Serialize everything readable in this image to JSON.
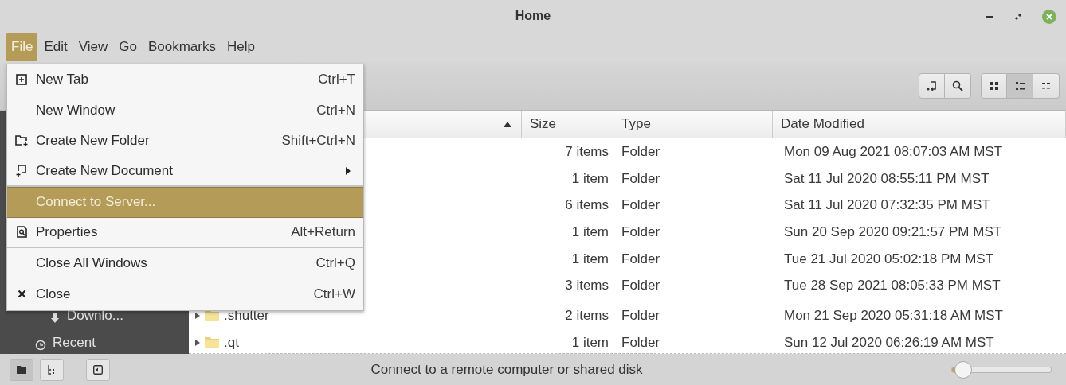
{
  "window": {
    "title": "Home"
  },
  "menubar": [
    {
      "label": "File",
      "selected": true
    },
    {
      "label": "Edit",
      "selected": false
    },
    {
      "label": "View",
      "selected": false
    },
    {
      "label": "Go",
      "selected": false
    },
    {
      "label": "Bookmarks",
      "selected": false
    },
    {
      "label": "Help",
      "selected": false
    }
  ],
  "file_menu": {
    "items": [
      {
        "kind": "new-tab",
        "label": "New Tab",
        "shortcut": "Ctrl+T",
        "selected": false,
        "submenu": false,
        "separator_after": false
      },
      {
        "kind": "plain",
        "label": "New Window",
        "shortcut": "Ctrl+N",
        "selected": false,
        "submenu": false,
        "separator_after": false
      },
      {
        "kind": "new-folder",
        "label": "Create New Folder",
        "shortcut": "Shift+Ctrl+N",
        "selected": false,
        "submenu": false,
        "separator_after": false
      },
      {
        "kind": "new-document",
        "label": "Create New Document",
        "selected": false,
        "submenu": true,
        "separator_after": true
      },
      {
        "kind": "plain",
        "label": "Connect to Server...",
        "selected": true,
        "submenu": false,
        "separator_after": false
      },
      {
        "kind": "properties",
        "label": "Properties",
        "shortcut": "Alt+Return",
        "selected": false,
        "submenu": false,
        "separator_after": true
      },
      {
        "kind": "plain",
        "label": "Close All Windows",
        "shortcut": "Ctrl+Q",
        "selected": false,
        "submenu": false,
        "separator_after": false
      },
      {
        "kind": "close",
        "label": "Close",
        "shortcut": "Ctrl+W",
        "selected": false,
        "submenu": false,
        "separator_after": false
      }
    ]
  },
  "toolbar": {
    "view_buttons": [
      {
        "kind": "icons",
        "selected": false
      },
      {
        "kind": "list",
        "selected": true
      },
      {
        "kind": "compact",
        "selected": false
      }
    ]
  },
  "sidebar": {
    "items": [
      {
        "kind": "download",
        "label": "Downlo..."
      },
      {
        "kind": "recent",
        "label": "Recent"
      }
    ]
  },
  "table": {
    "sort_ascending": true,
    "columns": [
      "Size",
      "Type",
      "Date Modified"
    ],
    "rows": [
      {
        "size": "7 items",
        "type": "Folder",
        "date_modified": "Mon 09 Aug 2021 08:07:03 AM MST"
      },
      {
        "size": "1 item",
        "type": "Folder",
        "date_modified": "Sat 11 Jul 2020 08:55:11 PM MST"
      },
      {
        "size": "6 items",
        "type": "Folder",
        "date_modified": "Sat 11 Jul 2020 07:32:35 PM MST"
      },
      {
        "size": "1 item",
        "type": "Folder",
        "date_modified": "Sun 20 Sep 2020 09:21:57 PM MST"
      },
      {
        "size": "1 item",
        "type": "Folder",
        "date_modified": "Tue 21 Jul 2020 05:02:18 PM MST"
      },
      {
        "size": "3 items",
        "type": "Folder",
        "date_modified": "Tue 28 Sep 2021 08:05:33 PM MST"
      },
      {
        "name": ".shutter",
        "size": "2 items",
        "type": "Folder",
        "date_modified": "Mon 21 Sep 2020 05:31:18 AM MST"
      },
      {
        "name": ".qt",
        "size": "1 item",
        "type": "Folder",
        "date_modified": "Sun 12 Jul 2020 06:26:19 AM MST"
      }
    ]
  },
  "status_bar": {
    "pane_buttons": [
      {
        "kind": "places",
        "selected": true
      },
      {
        "kind": "tree",
        "selected": false
      }
    ],
    "sidebar_toggle": {
      "selected": false
    },
    "message": "Connect to a remote computer or shared disk",
    "zoom": {
      "level": 0.12
    }
  }
}
